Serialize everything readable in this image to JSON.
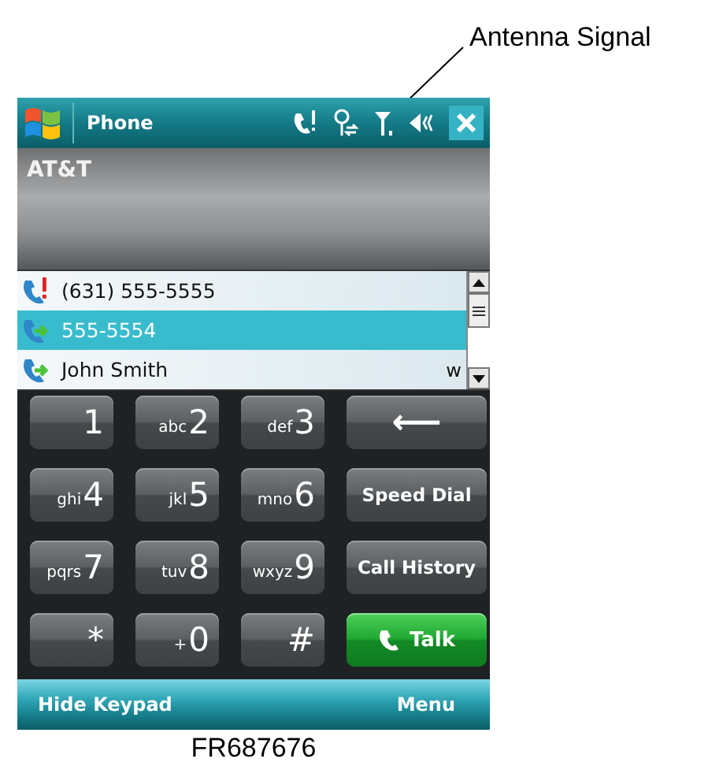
{
  "annotation": {
    "label": "Antenna Signal"
  },
  "title_bar": {
    "title": "Phone"
  },
  "carrier": "AT&T",
  "call_list": [
    {
      "kind": "missed",
      "text": "(631) 555-5555",
      "selected": false
    },
    {
      "kind": "outgoing",
      "text": "555-5554",
      "selected": true
    },
    {
      "kind": "outgoing",
      "text": "John Smith",
      "selected": false,
      "tag": "w"
    }
  ],
  "keypad": [
    {
      "kind": "digit",
      "label": "1"
    },
    {
      "kind": "digit",
      "letters": "abc",
      "label": "2"
    },
    {
      "kind": "digit",
      "letters": "def",
      "label": "3"
    },
    {
      "kind": "backspace",
      "label": "⟵"
    },
    {
      "kind": "digit",
      "letters": "ghi",
      "label": "4"
    },
    {
      "kind": "digit",
      "letters": "jkl",
      "label": "5"
    },
    {
      "kind": "digit",
      "letters": "mno",
      "label": "6"
    },
    {
      "kind": "action",
      "label": "Speed Dial"
    },
    {
      "kind": "digit",
      "letters": "pqrs",
      "label": "7"
    },
    {
      "kind": "digit",
      "letters": "tuv",
      "label": "8"
    },
    {
      "kind": "digit",
      "letters": "wxyz",
      "label": "9"
    },
    {
      "kind": "action",
      "label": "Call History"
    },
    {
      "kind": "digit",
      "label": "*"
    },
    {
      "kind": "digit",
      "letters": "+",
      "label": "0"
    },
    {
      "kind": "digit",
      "label": "#"
    },
    {
      "kind": "talk",
      "label": "Talk"
    }
  ],
  "soft_keys": [
    "Hide Keypad",
    "Menu"
  ],
  "caption": "FR687676"
}
